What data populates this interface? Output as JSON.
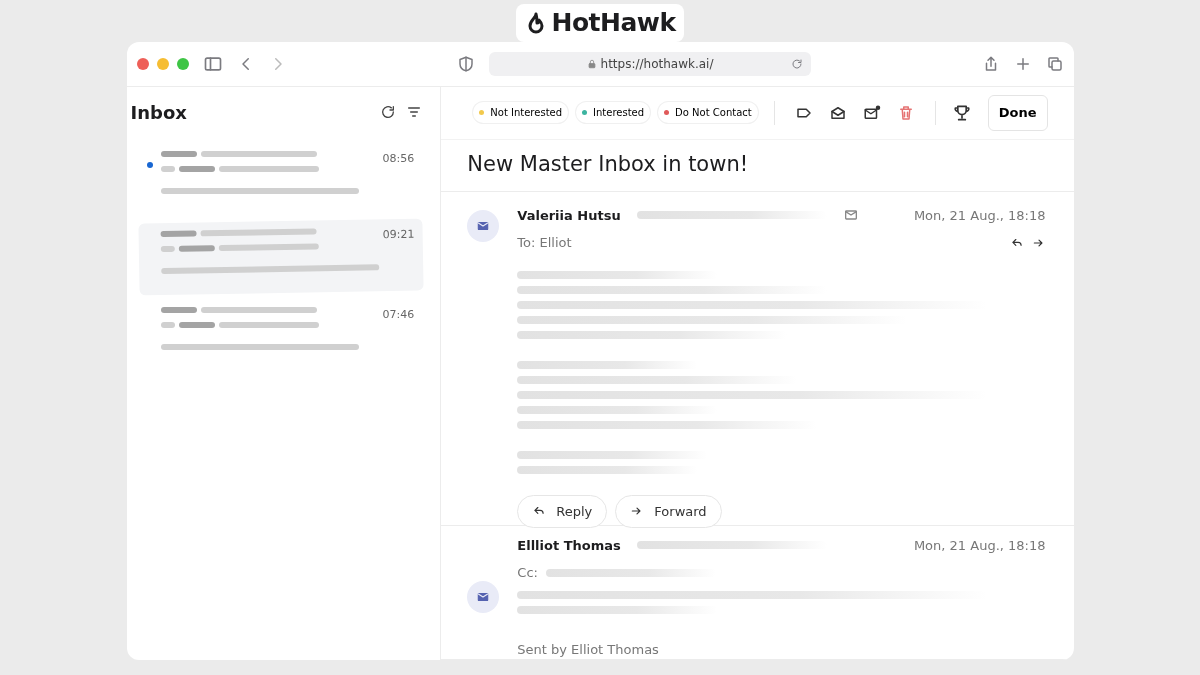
{
  "brand": {
    "name": "HotHawk"
  },
  "browser": {
    "url": "https://hothawk.ai/"
  },
  "sidebar": {
    "title": "Inbox",
    "items": [
      {
        "time": "08:56",
        "unread": true,
        "selected": false
      },
      {
        "time": "09:21",
        "unread": false,
        "selected": true
      },
      {
        "time": "07:46",
        "unread": false,
        "selected": false
      }
    ]
  },
  "toolbar": {
    "tags": [
      {
        "label": "Not Interested",
        "color": "#f2c94c"
      },
      {
        "label": "Interested",
        "color": "#3cb4a0"
      },
      {
        "label": "Do Not Contact",
        "color": "#e05a5a"
      }
    ],
    "done_button": "Done"
  },
  "thread": {
    "subject": "New Master Inbox in town!",
    "messages": [
      {
        "sender": "Valeriia Hutsu",
        "recipient": "To: Elliot",
        "date": "Mon, 21 Aug., 18:18",
        "actions": [
          "Reply",
          "Forward"
        ]
      },
      {
        "sender": "Ellliot Thomas",
        "recipient": "Cc:",
        "date": "Mon, 21 Aug., 18:18",
        "footer": "Sent by Elliot Thomas"
      }
    ]
  }
}
